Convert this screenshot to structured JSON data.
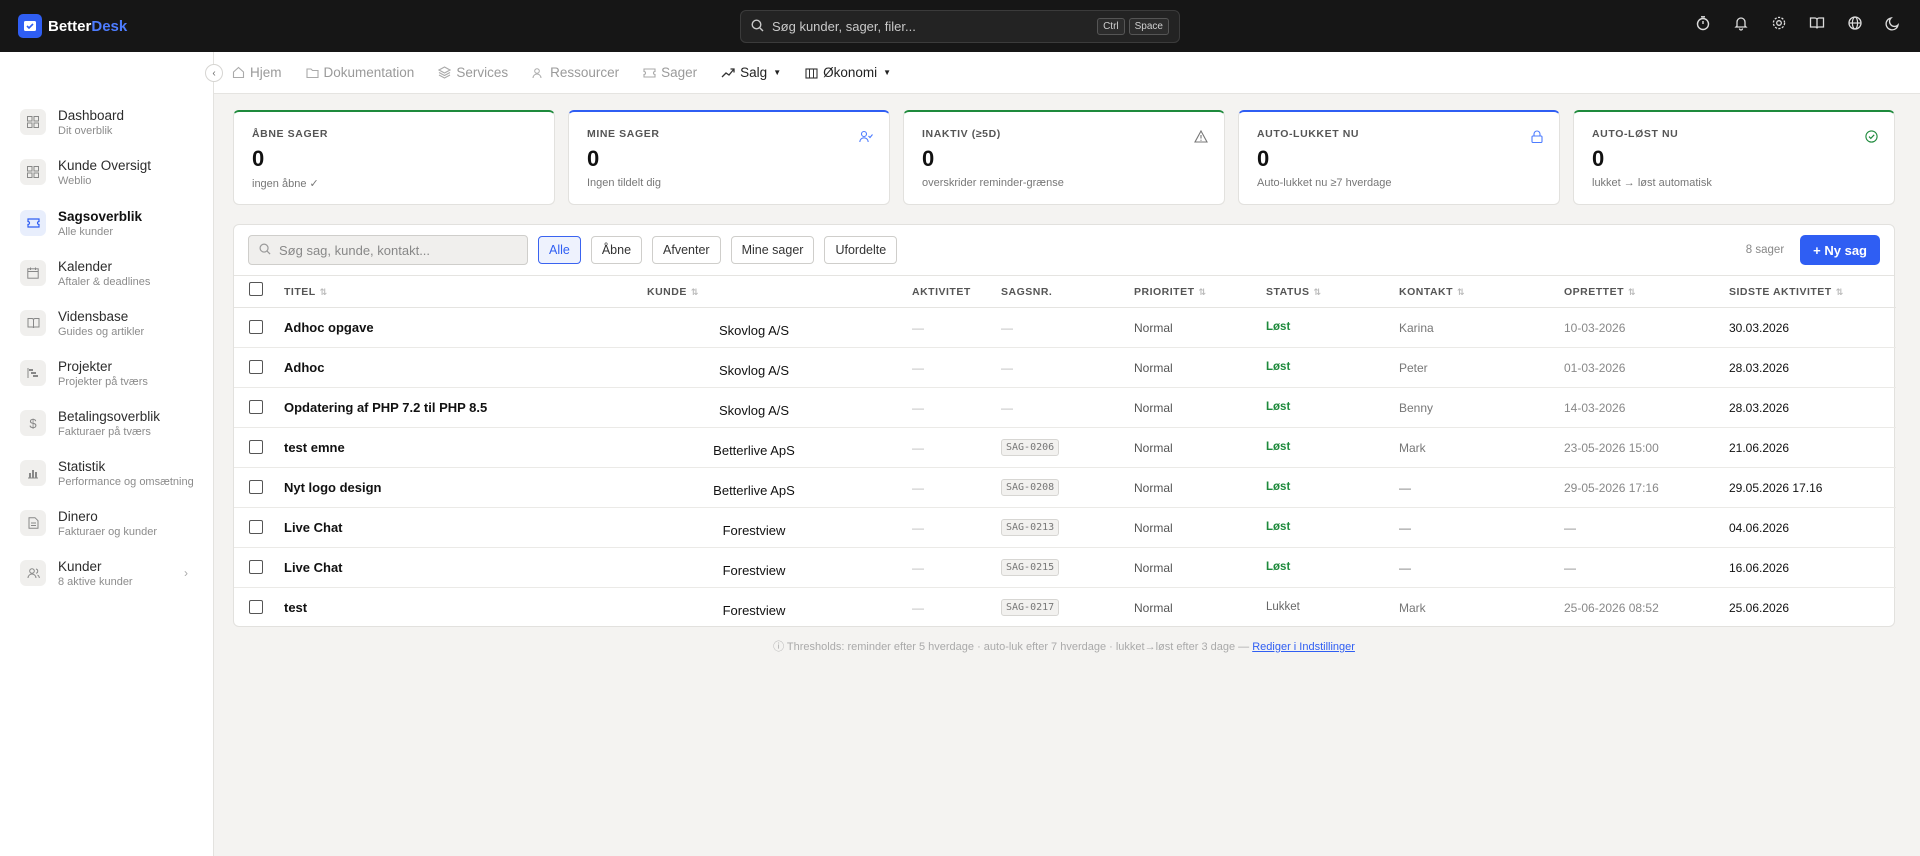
{
  "app": {
    "logo_main": "Better",
    "logo_accent": "Desk"
  },
  "search": {
    "placeholder": "Søg kunder, sager, filer...",
    "kbd1": "Ctrl",
    "kbd2": "Space"
  },
  "top_icons": [
    "timer-icon",
    "bell-icon",
    "gear-icon",
    "book-icon",
    "globe-icon",
    "moon-icon"
  ],
  "sidebar": {
    "items": [
      {
        "label": "Dashboard",
        "sub": "Dit overblik",
        "icon": "grid-icon"
      },
      {
        "label": "Kunde Oversigt",
        "sub": "Weblio",
        "icon": "grid-icon"
      },
      {
        "label": "Sagsoverblik",
        "sub": "Alle kunder",
        "icon": "ticket-icon",
        "active": true
      },
      {
        "label": "Kalender",
        "sub": "Aftaler & deadlines",
        "icon": "calendar-icon"
      },
      {
        "label": "Vidensbase",
        "sub": "Guides og artikler",
        "icon": "book-icon"
      },
      {
        "label": "Projekter",
        "sub": "Projekter på tværs",
        "icon": "gantt-icon"
      },
      {
        "label": "Betalingsoverblik",
        "sub": "Fakturaer på tværs",
        "icon": "dollar-icon"
      },
      {
        "label": "Statistik",
        "sub": "Performance og omsætning",
        "icon": "chart-icon"
      },
      {
        "label": "Dinero",
        "sub": "Fakturaer og kunder",
        "icon": "invoice-icon"
      },
      {
        "label": "Kunder",
        "sub": "8 aktive kunder",
        "icon": "users-icon",
        "chevron": "›"
      }
    ]
  },
  "topnav": {
    "items": [
      "Hjem",
      "Dokumentation",
      "Services",
      "Ressourcer",
      "Sager",
      "Salg",
      "Økonomi"
    ]
  },
  "stats": [
    {
      "title": "ÅBNE SAGER",
      "value": "0",
      "sub": "ingen åbne ✓",
      "color": "#1e8a3c"
    },
    {
      "title": "MINE SAGER",
      "value": "0",
      "sub": "Ingen tildelt dig",
      "color": "#2f5ef3"
    },
    {
      "title": "INAKTIV (≥5D)",
      "value": "0",
      "sub": "overskrider reminder-grænse",
      "color": "#1e8a3c"
    },
    {
      "title": "AUTO-LUKKET NU",
      "value": "0",
      "sub": "Auto-lukket nu ≥7 hverdage",
      "color": "#2f5ef3"
    },
    {
      "title": "AUTO-LØST NU",
      "value": "0",
      "sub": "lukket → løst automatisk",
      "color": "#1e8a3c"
    }
  ],
  "toolbar": {
    "search_placeholder": "Søg sag, kunde, kontakt...",
    "filters": [
      "Alle",
      "Åbne",
      "Afventer",
      "Mine sager",
      "Ufordelte"
    ],
    "count": "8 sager",
    "new_button": "+ Ny sag"
  },
  "table": {
    "headers": [
      "TITEL",
      "KUNDE",
      "AKTIVITET",
      "SAGSNR.",
      "PRIORITET",
      "STATUS",
      "KONTAKT",
      "OPRETTET",
      "SIDSTE AKTIVITET"
    ],
    "rows": [
      {
        "title": "Adhoc opgave",
        "kunde": "Skovlog A/S",
        "aktivitet": "—",
        "sagsnr": "—",
        "prioritet": "Normal",
        "status": "Løst",
        "kontakt": "Karina",
        "oprettet": "10-03-2026",
        "sidste": "30.03.2026"
      },
      {
        "title": "Adhoc",
        "kunde": "Skovlog A/S",
        "aktivitet": "—",
        "sagsnr": "—",
        "prioritet": "Normal",
        "status": "Løst",
        "kontakt": "Peter",
        "oprettet": "01-03-2026",
        "sidste": "28.03.2026"
      },
      {
        "title": "Opdatering af PHP 7.2 til PHP 8.5",
        "kunde": "Skovlog A/S",
        "aktivitet": "—",
        "sagsnr": "—",
        "prioritet": "Normal",
        "status": "Løst",
        "kontakt": "Benny",
        "oprettet": "14-03-2026",
        "sidste": "28.03.2026"
      },
      {
        "title": "test emne",
        "kunde": "Betterlive ApS",
        "aktivitet": "—",
        "sagsnr": "SAG-0206",
        "prioritet": "Normal",
        "status": "Løst",
        "kontakt": "Mark",
        "oprettet": "23-05-2026 15:00",
        "sidste": "21.06.2026"
      },
      {
        "title": "Nyt logo design",
        "kunde": "Betterlive ApS",
        "aktivitet": "—",
        "sagsnr": "SAG-0208",
        "prioritet": "Normal",
        "status": "Løst",
        "kontakt": "—",
        "oprettet": "29-05-2026 17:16",
        "sidste": "29.05.2026 17.16"
      },
      {
        "title": "Live Chat",
        "kunde": "Forestview",
        "aktivitet": "—",
        "sagsnr": "SAG-0213",
        "prioritet": "Normal",
        "status": "Løst",
        "kontakt": "—",
        "oprettet": "—",
        "sidste": "04.06.2026"
      },
      {
        "title": "Live Chat",
        "kunde": "Forestview",
        "aktivitet": "—",
        "sagsnr": "SAG-0215",
        "prioritet": "Normal",
        "status": "Løst",
        "kontakt": "—",
        "oprettet": "—",
        "sidste": "16.06.2026"
      },
      {
        "title": "test",
        "kunde": "Forestview",
        "aktivitet": "—",
        "sagsnr": "SAG-0217",
        "prioritet": "Normal",
        "status": "Lukket",
        "kontakt": "Mark",
        "oprettet": "25-06-2026 08:52",
        "sidste": "25.06.2026"
      }
    ]
  },
  "footer": {
    "note": "ⓘ Thresholds: reminder efter 5 hverdage · auto-luk efter 7 hverdage · lukket→løst efter 3 dage —",
    "link": "Rediger i Indstillinger"
  }
}
